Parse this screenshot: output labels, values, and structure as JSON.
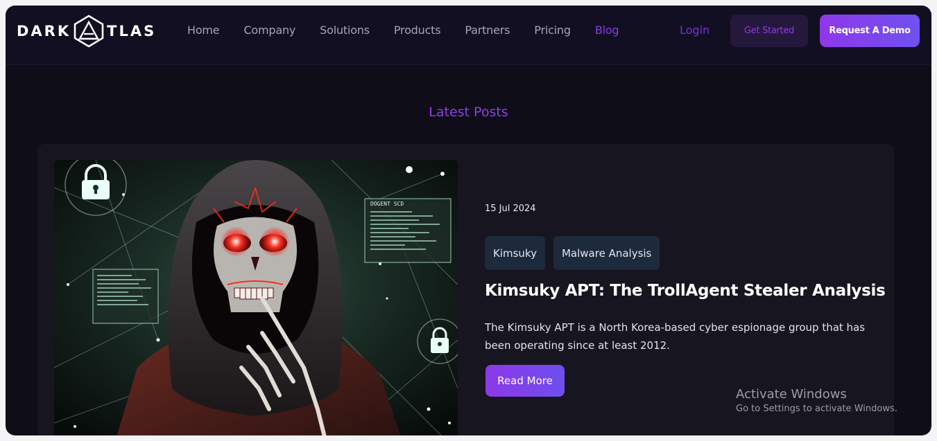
{
  "brand": {
    "logo_text_left": "DARK",
    "logo_text_right": "TLAS"
  },
  "nav": {
    "links": [
      "Home",
      "Company",
      "Solutions",
      "Products",
      "Partners",
      "Pricing",
      "Blog"
    ],
    "active": "Blog",
    "login": "Login",
    "get_started": "Get Started",
    "request_demo": "Request A Demo"
  },
  "section": {
    "title": "Latest Posts"
  },
  "post": {
    "date": "15 Jul 2024",
    "tags": [
      "Kimsuky",
      "Malware Analysis"
    ],
    "title": "Kimsuky APT: The TrollAgent Stealer Analysis",
    "excerpt": "The Kimsuky APT is a North Korea-based cyber espionage group that has been operating since at least 2012.",
    "read_more": "Read More"
  },
  "image_text": {
    "panel_label": "DOGENT SCD"
  },
  "watermark": {
    "title": "Activate Windows",
    "subtitle": "Go to Settings to activate Windows."
  },
  "colors": {
    "accent": "#8b3ae4",
    "background": "#0e0d18",
    "navbar": "#120f22",
    "card": "#17151f",
    "tag": "#1d2a3c"
  }
}
